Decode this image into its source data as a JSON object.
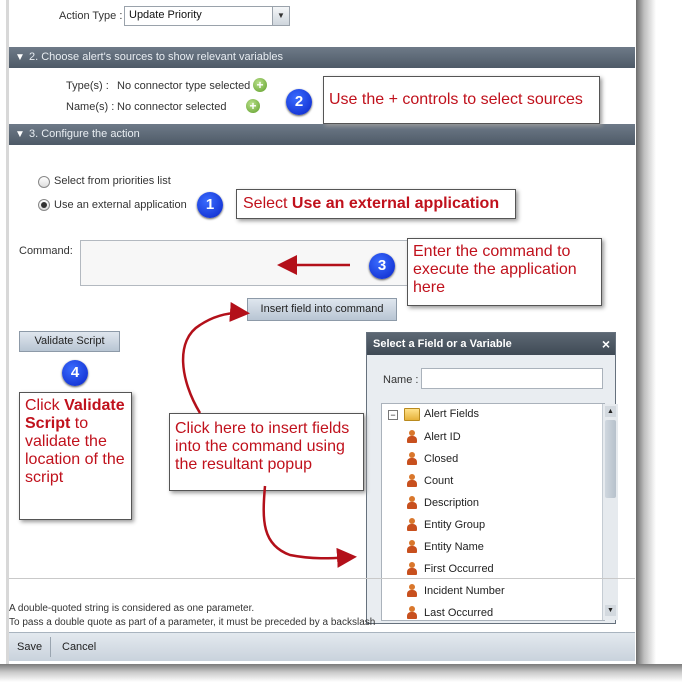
{
  "action_type": {
    "label": "Action Type :",
    "value": "Update Priority"
  },
  "section2": {
    "title": "2. Choose alert's sources to show relevant variables"
  },
  "types_label": "Type(s) :",
  "types_value": "No connector type selected",
  "names_label": "Name(s) :",
  "names_value": "No connector selected",
  "section3": {
    "title": "3. Configure the action"
  },
  "radio_priorities": "Select from priorities list",
  "radio_external": "Use an external application",
  "command_label": "Command:",
  "insert_button": "Insert field into command",
  "validate_button": "Validate Script",
  "popup": {
    "title": "Select a Field or a Variable",
    "close": "×",
    "name_label": "Name :",
    "root": "Alert Fields",
    "fields": [
      "Alert ID",
      "Closed",
      "Count",
      "Description",
      "Entity Group",
      "Entity Name",
      "First Occurred",
      "Incident Number",
      "Last Occurred"
    ]
  },
  "callouts": {
    "c1_prefix": "Select ",
    "c1_bold": "Use an external application",
    "c2": "Use the + controls to select sources",
    "c3": "Enter the command to execute the application here",
    "c4_a": "Click ",
    "c4_bold": "Validate Script",
    "c4_b": " to validate the location of the script",
    "c5": "Click here to insert fields into the command using the resultant popup"
  },
  "badges": [
    "1",
    "2",
    "3",
    "4"
  ],
  "notes": {
    "line1": "A double-quoted string is considered as one parameter.",
    "line2": "To pass a double quote as part of a parameter, it must be preceded by a backslash"
  },
  "footer": {
    "save": "Save",
    "cancel": "Cancel"
  },
  "colors": {
    "callout_text": "#c0111c",
    "badge": "#0a25c8",
    "section_bar": "#56626f"
  }
}
